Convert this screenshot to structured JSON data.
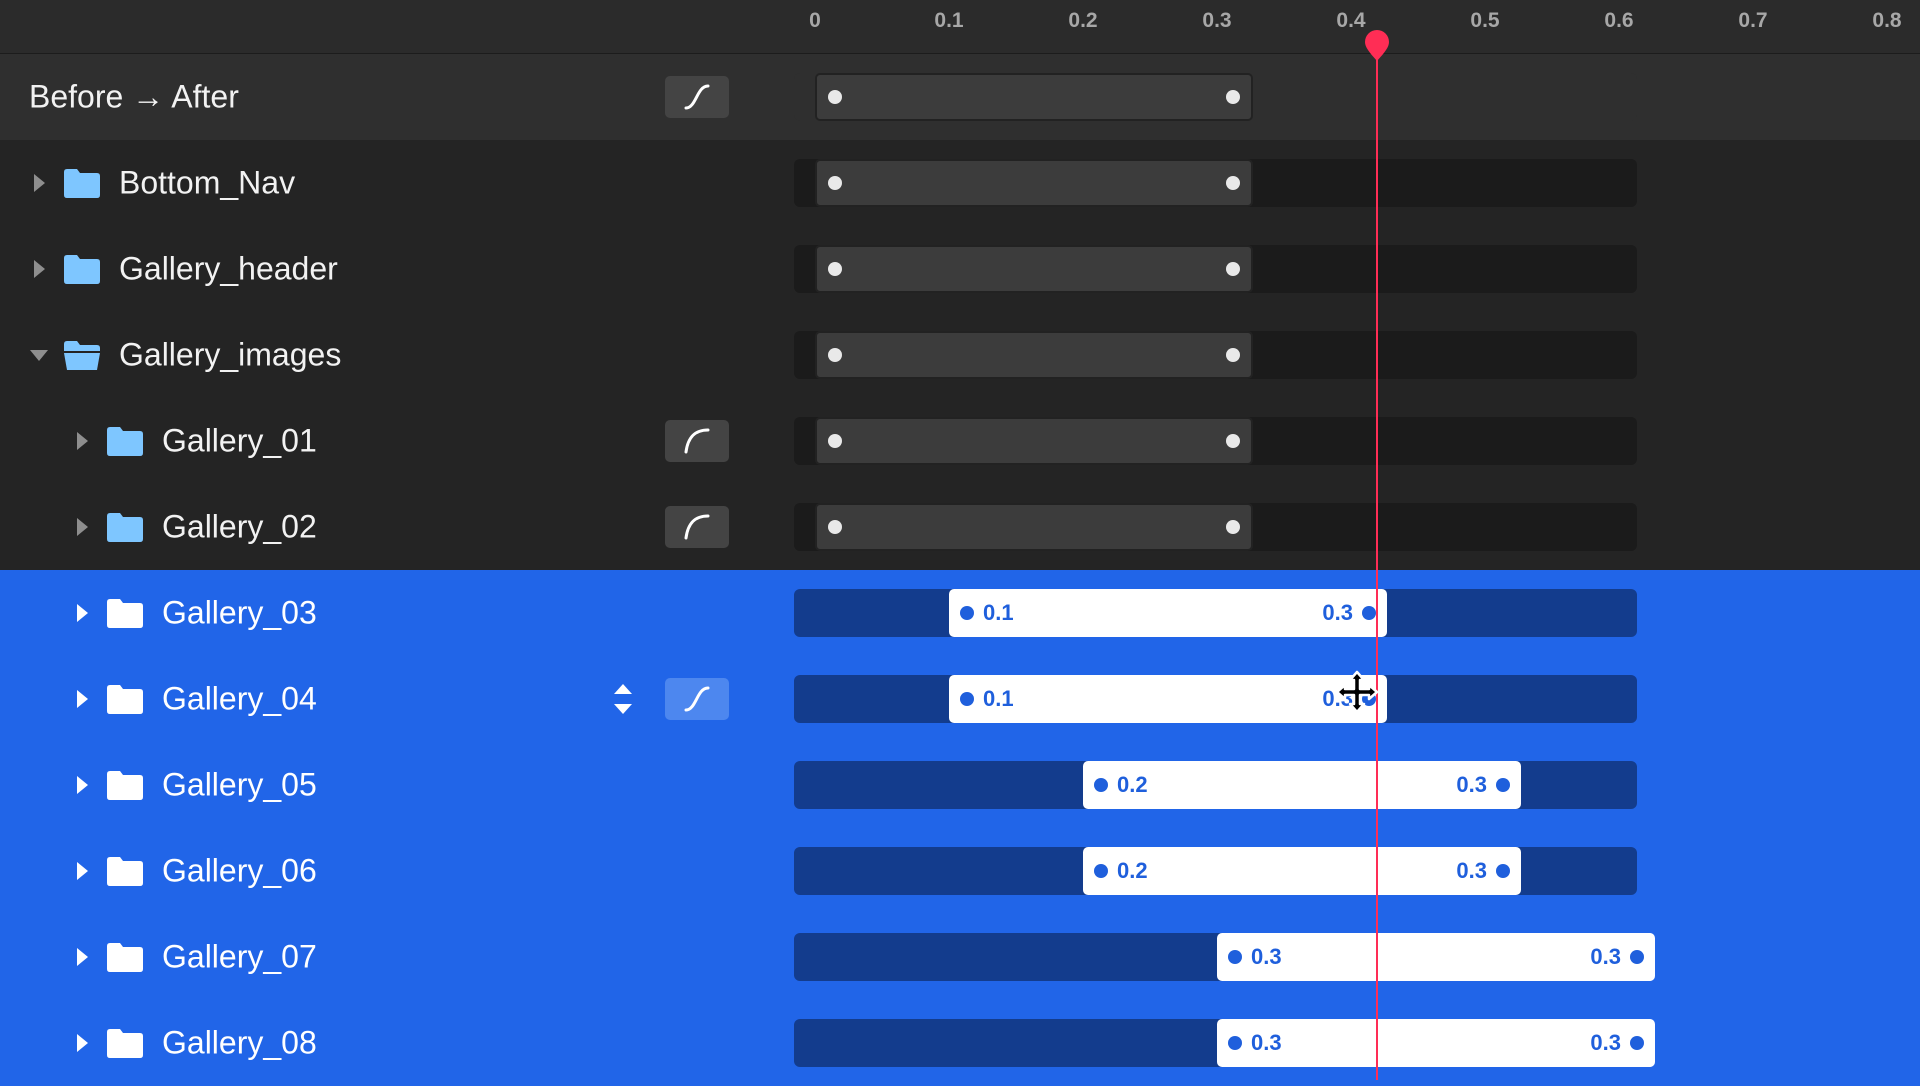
{
  "ruler": {
    "ticks": [
      "0",
      "0.1",
      "0.2",
      "0.3",
      "0.4",
      "0.5",
      "0.6",
      "0.7",
      "0.8"
    ]
  },
  "playhead": {
    "time": 0.42,
    "color": "#ff2d55"
  },
  "colors": {
    "selection": "#2165e8",
    "accent": "#1f5fdc",
    "folder": "#7ec6ff",
    "playhead": "#ff2d55"
  },
  "transition": {
    "label": "Before → After",
    "range_start": 0,
    "range_end": 0.3
  },
  "layers": [
    {
      "name": "Bottom_Nav",
      "range_start": 0,
      "range_end": 0.3,
      "selected": false
    },
    {
      "name": "Gallery_header",
      "range_start": 0,
      "range_end": 0.3,
      "selected": false
    },
    {
      "name": "Gallery_images",
      "range_start": 0,
      "range_end": 0.3,
      "selected": false,
      "expanded": true
    },
    {
      "name": "Gallery_01",
      "range_start": 0,
      "range_end": 0.3,
      "selected": false,
      "ease_icon": "ease-out-curve-icon"
    },
    {
      "name": "Gallery_02",
      "range_start": 0,
      "range_end": 0.3,
      "selected": false,
      "ease_icon": "ease-out-curve-icon"
    },
    {
      "name": "Gallery_03",
      "range_start": 0.1,
      "range_end": 0.4,
      "selected": true,
      "delay_label": "0.1",
      "duration_label": "0.3"
    },
    {
      "name": "Gallery_04",
      "range_start": 0.1,
      "range_end": 0.4,
      "selected": true,
      "delay_label": "0.1",
      "duration_label": "0.3",
      "ease_icon": "ease-in-out-curve-icon"
    },
    {
      "name": "Gallery_05",
      "range_start": 0.2,
      "range_end": 0.5,
      "selected": true,
      "delay_label": "0.2",
      "duration_label": "0.3"
    },
    {
      "name": "Gallery_06",
      "range_start": 0.2,
      "range_end": 0.5,
      "selected": true,
      "delay_label": "0.2",
      "duration_label": "0.3"
    },
    {
      "name": "Gallery_07",
      "range_start": 0.3,
      "range_end": 0.6,
      "selected": true,
      "delay_label": "0.3",
      "duration_label": "0.3"
    },
    {
      "name": "Gallery_08",
      "range_start": 0.3,
      "range_end": 0.6,
      "selected": true,
      "delay_label": "0.3",
      "duration_label": "0.3"
    }
  ]
}
